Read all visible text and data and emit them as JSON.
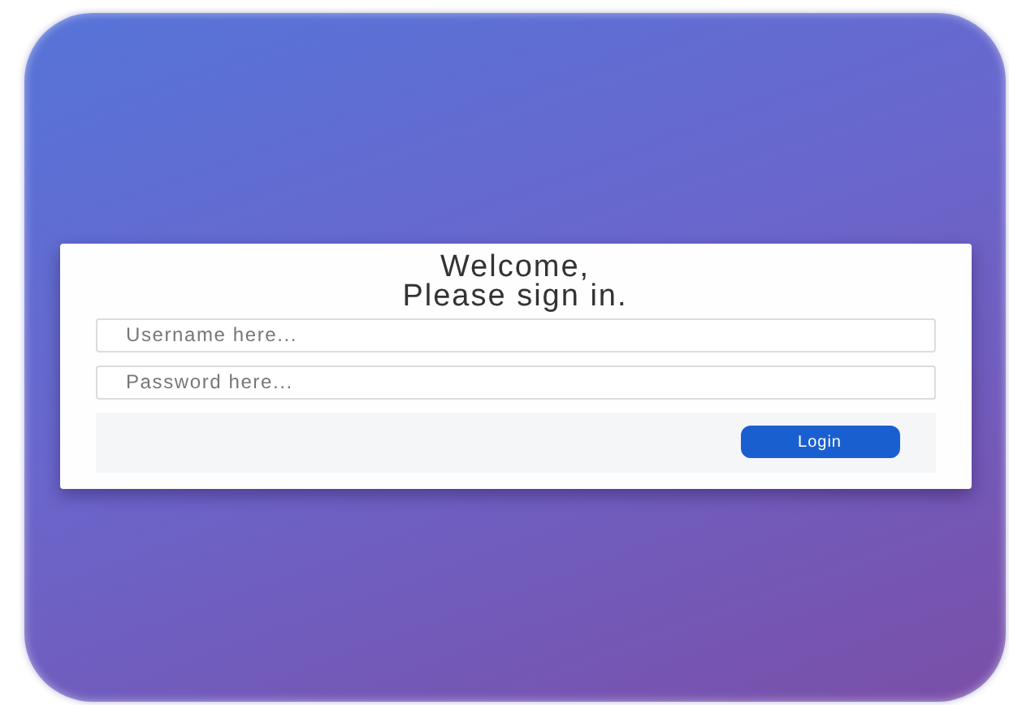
{
  "login_card": {
    "heading": [
      "Welcome,",
      "Please sign in."
    ],
    "fields": [
      {
        "placeholder": "Username here..."
      },
      {
        "placeholder": "Password here..."
      }
    ],
    "button": "Login"
  }
}
